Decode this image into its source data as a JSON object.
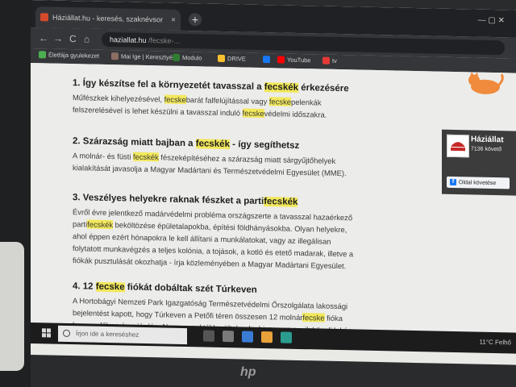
{
  "browser": {
    "tab_title": "Háziállat.hu - keresés, szaknévsor",
    "tab_close": "×",
    "new_tab": "+",
    "window_controls": "—   ▢   ✕",
    "nav_back": "←",
    "nav_forward": "→",
    "reload": "C",
    "home": "⌂",
    "url_host": "haziallat.hu",
    "url_rest": " /fecske-...",
    "bookmarks": [
      {
        "label": "Életfája gyulekezet",
        "color": "#4caf50"
      },
      {
        "label": "Mai Ige | Keresztyé...",
        "color": "#8d6e63"
      },
      {
        "label": "Modulo",
        "color": "#2e7d32"
      },
      {
        "label": "DRIVE",
        "color": "#fbc02d"
      },
      {
        "label": "",
        "color": "#1877f2"
      },
      {
        "label": "YouTube",
        "color": "#ff0000"
      },
      {
        "label": "tv",
        "color": "#e53935"
      }
    ]
  },
  "article": {
    "sections": [
      {
        "heading_parts": [
          "1. Így készítse fel a környezetét tavasszal a ",
          "fecskék",
          " érkezésére"
        ],
        "body_lines": [
          [
            "Műfészkek kihelyezésével, ",
            "fecske",
            "barát falfelújítással vagy ",
            "fecske",
            "pelenkák"
          ],
          [
            "felszerelésével is lehet készülni a tavasszal induló ",
            "fecske",
            "védelmi időszakra."
          ]
        ]
      },
      {
        "heading_parts": [
          "2. Szárazság miatt bajban a ",
          "fecskék",
          " - így segíthetsz"
        ],
        "body_lines": [
          [
            "A molnár- és füsti ",
            "fecskék",
            " fészeképítéséhez a szárazság miatt sárgyűjtőhelyek"
          ],
          [
            "kialakítását javasolja a Magyar Madártani és Természetvédelmi Egyesület (MME)."
          ]
        ]
      },
      {
        "heading_parts": [
          "3. Veszélyes helyekre raknak fészket a parti",
          "fecskék"
        ],
        "body_lines": [
          [
            "Évről évre jelentkező madárvédelmi probléma országszerte a tavasszal hazaérkező"
          ],
          [
            "parti",
            "fecskék",
            " beköltözése épületalapokba, építési földhányásokba. Olyan helyekre,"
          ],
          [
            "ahol éppen ezért hónapokra le kell állítani a munkálatokat, vagy az illegálisan"
          ],
          [
            "folytatott munkavégzés a teljes kolónia, a tojások, a kotló és etető madarak, illetve a"
          ],
          [
            "fiókák pusztulását okozhatja - írja közleményében a Magyar Madártani Egyesület."
          ]
        ]
      },
      {
        "heading_parts": [
          "4. 12 ",
          "fecske",
          " fiókát dobáltak szét Túrkeven"
        ],
        "body_lines": [
          [
            "A Hortobágyi Nemzeti Park Igazgatóság Természetvédelmi Őrszolgálata lakossági"
          ],
          [
            "bejelentést kapott, hogy Túrkeven a Petőfi téren összesen 12 molnár",
            "fecske",
            " fióka"
          ],
          [
            "hever a fűben és a járdán. Nem maguktól kerültek oda, hiszen az egyik közeli lakás"
          ]
        ]
      }
    ]
  },
  "sidebar": {
    "fb_name": "Háziállat",
    "fb_count": "7136 követő",
    "fb_follow_icon": "f",
    "fb_follow": "Oldal követése"
  },
  "taskbar": {
    "search_placeholder": "Írjon ide a kereséshez",
    "tray_text": "11°C  Felhő",
    "icons": [
      "#555",
      "#7a7a7a",
      "#3a7bd5",
      "#e8a23a",
      "#2a9d8f"
    ]
  },
  "bezel": {
    "brand": "hp"
  }
}
